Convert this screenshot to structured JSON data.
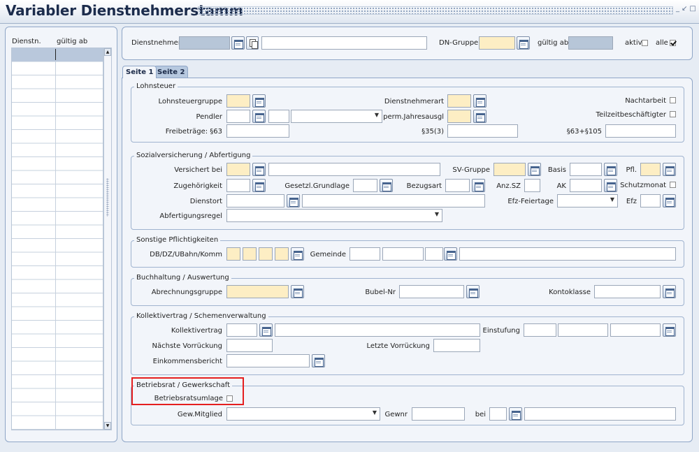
{
  "window": {
    "title": "Variabler Dienstnehmerstamm"
  },
  "list": {
    "col_dienstn": "Dienstn.",
    "col_gueltig_ab": "gültig ab"
  },
  "header": {
    "dienstnehmer_label": "Dienstnehmer",
    "dn_gruppe_label": "DN-Gruppe",
    "gueltig_ab_label": "gültig ab",
    "aktiv_label": "aktiv",
    "alle_label": "alle"
  },
  "tabs": [
    {
      "label": "Seite 1"
    },
    {
      "label": "Seite 2"
    }
  ],
  "lohnsteuer": {
    "title": "Lohnsteuer",
    "lohnsteuergruppe": "Lohnsteuergruppe",
    "dienstnehmerart": "Dienstnehmerart",
    "nachtarbeit": "Nachtarbeit",
    "pendler": "Pendler",
    "perm_jahresausgl": "perm.Jahresausgl",
    "teilzeitbeschaeftigter": "Teilzeitbeschäftigter",
    "freibetraege": "Freibeträge: §63",
    "p35_3": "§35(3)",
    "p63_105": "§63+§105"
  },
  "sv": {
    "title": "Sozialversicherung / Abfertigung",
    "versichert_bei": "Versichert bei",
    "sv_gruppe": "SV-Gruppe",
    "basis": "Basis",
    "pfl": "Pfl.",
    "zugehoerigkeit": "Zugehörigkeit",
    "gesetzl_grundlage": "Gesetzl.Grundlage",
    "bezugsart": "Bezugsart",
    "anz_sz": "Anz.SZ",
    "ak": "AK",
    "schutzmonat": "Schutzmonat",
    "dienstort": "Dienstort",
    "efz_feiertage": "Efz-Feiertage",
    "efz": "Efz",
    "abfertigungsregel": "Abfertigungsregel"
  },
  "sonstige": {
    "title": "Sonstige Pflichtigkeiten",
    "db_dz": "DB/DZ/UBahn/Komm",
    "gemeinde": "Gemeinde"
  },
  "buchhaltung": {
    "title": "Buchhaltung / Auswertung",
    "abrechnungsgruppe": "Abrechnungsgruppe",
    "bubel_nr": "Bubel-Nr",
    "kontoklasse": "Kontoklasse"
  },
  "kv": {
    "title": "Kollektivertrag / Schemenverwaltung",
    "kollektivertrag": "Kollektivertrag",
    "einstufung": "Einstufung",
    "naechste_vorrueckung": "Nächste Vorrückung",
    "letzte_vorrueckung": "Letzte Vorrückung",
    "einkommensbericht": "Einkommensbericht"
  },
  "br": {
    "title": "Betriebsrat / Gewerkschaft",
    "betriebsratsumlage": "Betriebsratsumlage",
    "gew_mitglied": "Gew.Mitglied",
    "gewnr": "Gewnr",
    "bei": "bei"
  },
  "icons": {
    "calendar": "calendar-icon",
    "copy": "copy-icon",
    "dropdown": "chevron-down-icon"
  },
  "colors": {
    "mandatory_field": "#fdeec4",
    "readonly_field": "#b7c6d8",
    "highlight_box": "#e51f1f"
  }
}
